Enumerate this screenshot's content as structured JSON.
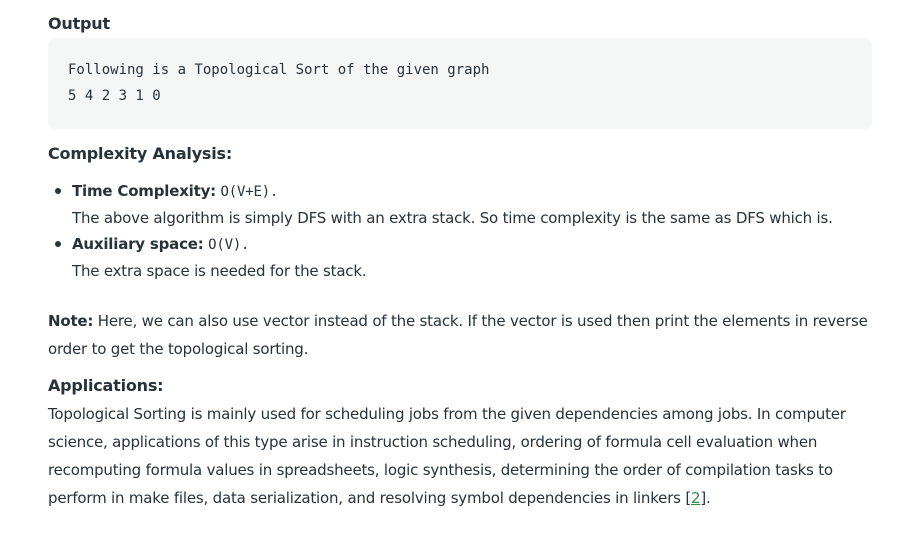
{
  "output": {
    "heading": "Output",
    "lines": [
      "Following is a Topological Sort of the given graph",
      "5 4 2 3 1 0"
    ]
  },
  "complexity": {
    "heading": "Complexity Analysis:",
    "items": [
      {
        "label": "Time Complexity:",
        "value": "O(V+E).",
        "description": "The above algorithm is simply DFS with an extra stack. So time complexity is the same as DFS which is."
      },
      {
        "label": "Auxiliary space:",
        "value": "O(V).",
        "description": "The extra space is needed for the stack."
      }
    ]
  },
  "note": {
    "label": "Note:",
    "text": " Here, we can also use vector instead of the stack. If the vector is used then print the elements in reverse order to get the topological sorting."
  },
  "applications": {
    "heading": "Applications:",
    "text": "Topological Sorting is mainly used for scheduling jobs from the given dependencies among jobs. In computer science, applications of this type arise in instruction scheduling, ordering of formula cell evaluation when recomputing formula values in spreadsheets, logic synthesis, determining the order of compilation tasks to perform in make files, data serialization, and resolving symbol dependencies in linkers ",
    "ref_open": "[",
    "ref_label": "2",
    "ref_close": "]."
  },
  "colors": {
    "text": "#273239",
    "code_bg": "#f5f6f6",
    "link": "#2f8d46"
  }
}
